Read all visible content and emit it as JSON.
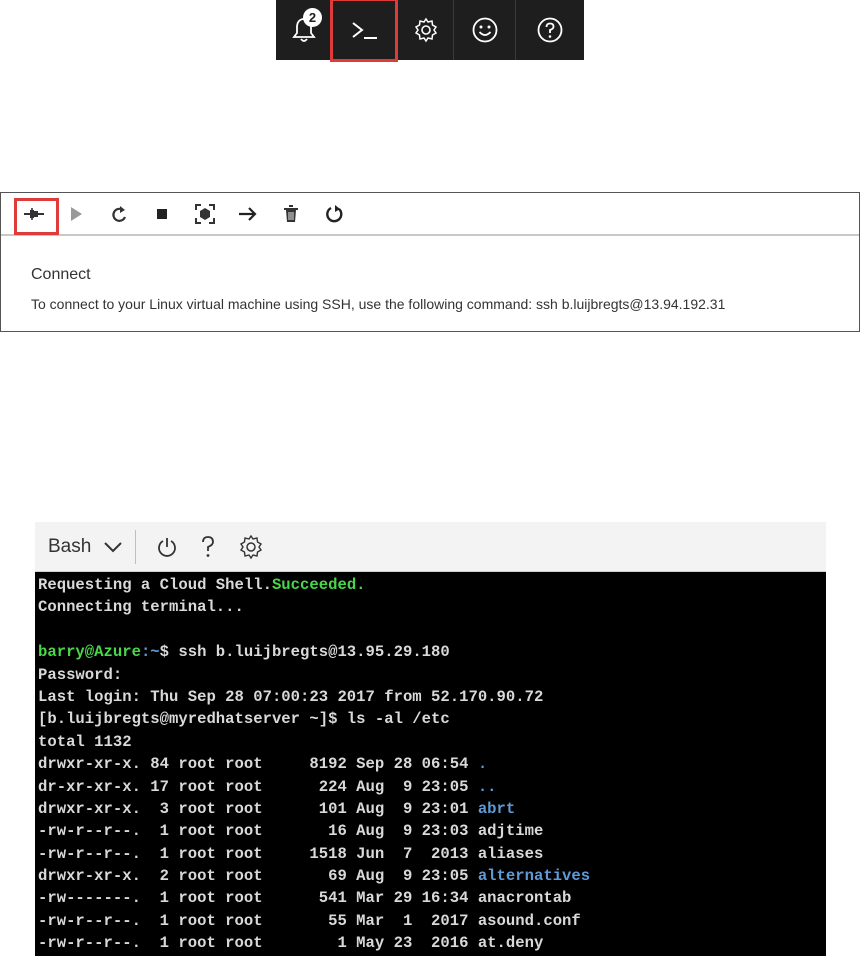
{
  "topbar": {
    "notification_count": "2",
    "buttons": [
      "bell-icon",
      "cloud-shell-icon",
      "gear-icon",
      "smiley-icon",
      "help-icon"
    ]
  },
  "vm_panel": {
    "toolbar_icons": [
      "connect-icon",
      "start-icon",
      "restart-icon",
      "stop-icon",
      "capture-icon",
      "move-icon",
      "delete-icon",
      "refresh-icon"
    ],
    "title": "Connect",
    "description": "To connect to your Linux virtual machine using SSH, use the following command: ssh b.luijbregts@13.94.192.31"
  },
  "cloud_shell": {
    "shell_type": "Bash",
    "terminal": {
      "line1_text": "Requesting a Cloud Shell.",
      "line1_status": "Succeeded.",
      "line2": "Connecting terminal...",
      "prompt_user": "barry@Azure",
      "prompt_path": ":~",
      "prompt_command": "$ ssh b.luijbregts@13.95.29.180",
      "password": "Password:",
      "last_login": "Last login: Thu Sep 28 07:00:23 2017 from 52.170.90.72",
      "ls_command": "[b.luijbregts@myredhatserver ~]$ ls -al /etc",
      "total": "total 1132",
      "listing": [
        {
          "meta": "drwxr-xr-x. 84 root root     8192 Sep 28 06:54 ",
          "name": ".",
          "dir": true
        },
        {
          "meta": "dr-xr-xr-x. 17 root root      224 Aug  9 23:05 ",
          "name": "..",
          "dir": true
        },
        {
          "meta": "drwxr-xr-x.  3 root root      101 Aug  9 23:01 ",
          "name": "abrt",
          "dir": true
        },
        {
          "meta": "-rw-r--r--.  1 root root       16 Aug  9 23:03 ",
          "name": "adjtime",
          "dir": false
        },
        {
          "meta": "-rw-r--r--.  1 root root     1518 Jun  7  2013 ",
          "name": "aliases",
          "dir": false
        },
        {
          "meta": "drwxr-xr-x.  2 root root       69 Aug  9 23:05 ",
          "name": "alternatives",
          "dir": true
        },
        {
          "meta": "-rw-------.  1 root root      541 Mar 29 16:34 ",
          "name": "anacrontab",
          "dir": false
        },
        {
          "meta": "-rw-r--r--.  1 root root       55 Mar  1  2017 ",
          "name": "asound.conf",
          "dir": false
        },
        {
          "meta": "-rw-r--r--.  1 root root        1 May 23  2016 ",
          "name": "at.deny",
          "dir": false
        }
      ]
    }
  },
  "colors": {
    "highlight": "#e03b3b",
    "terminal_bg": "#000000",
    "success_green": "#49d649",
    "dir_blue": "#5f9ad6"
  }
}
